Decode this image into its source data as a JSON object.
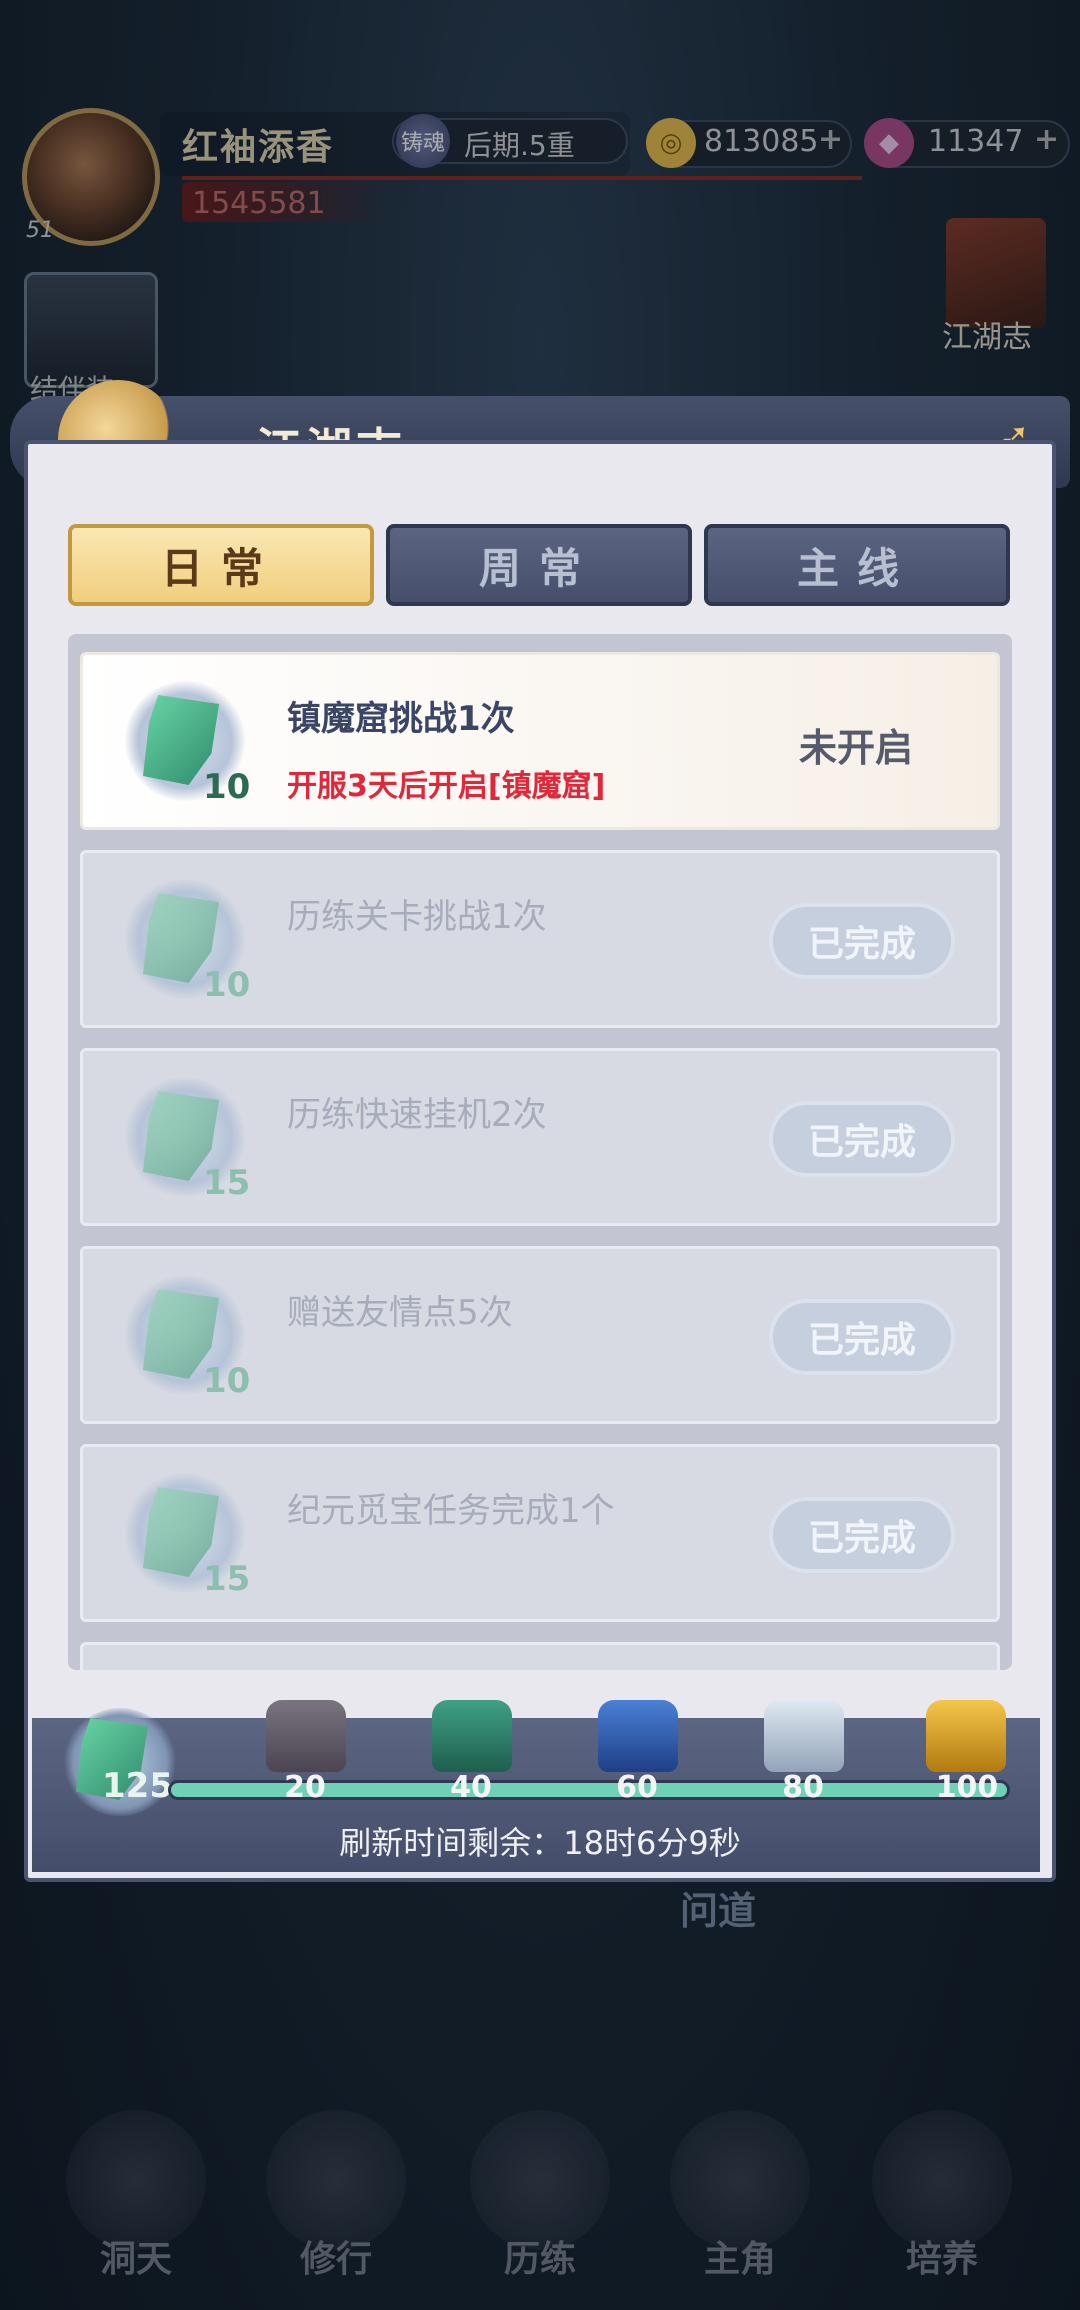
{
  "hud": {
    "player_name": "红袖添香",
    "level": "51",
    "realm_icon_char": "铸魂",
    "realm": "后期.5重",
    "power": "1545581",
    "copper": "813085",
    "gems": "11347",
    "plus": "+",
    "right_entry": "江湖志",
    "left_entry": "结伴装"
  },
  "background": {
    "wendao": "问道"
  },
  "modal": {
    "title": "江湖志",
    "tabs": [
      {
        "label": "日常",
        "active": true
      },
      {
        "label": "周常",
        "active": false
      },
      {
        "label": "主线",
        "active": false
      }
    ],
    "tasks": [
      {
        "title": "镇魔窟挑战1次",
        "reward": "10",
        "desc": "开服3天后开启[镇魔窟]",
        "status": "未开启",
        "state": "locked"
      },
      {
        "title": "历练关卡挑战1次",
        "reward": "10",
        "status": "已完成",
        "state": "done"
      },
      {
        "title": "历练快速挂机2次",
        "reward": "15",
        "status": "已完成",
        "state": "done"
      },
      {
        "title": "赠送友情点5次",
        "reward": "10",
        "status": "已完成",
        "state": "done"
      },
      {
        "title": "纪元觅宝任务完成1个",
        "reward": "15",
        "status": "已完成",
        "state": "done"
      }
    ],
    "progress": {
      "points": "125",
      "milestones": [
        "20",
        "40",
        "60",
        "80",
        "100"
      ],
      "chest_colors": [
        "#5a5560",
        "#2f7a66",
        "#2e5fb0",
        "#b8c6d6",
        "#e0a82a"
      ]
    },
    "refresh": "刷新时间剩余：18时6分9秒"
  },
  "nav": [
    {
      "label": "洞天"
    },
    {
      "label": "修行"
    },
    {
      "label": "历练"
    },
    {
      "label": "主角"
    },
    {
      "label": "培养"
    }
  ]
}
